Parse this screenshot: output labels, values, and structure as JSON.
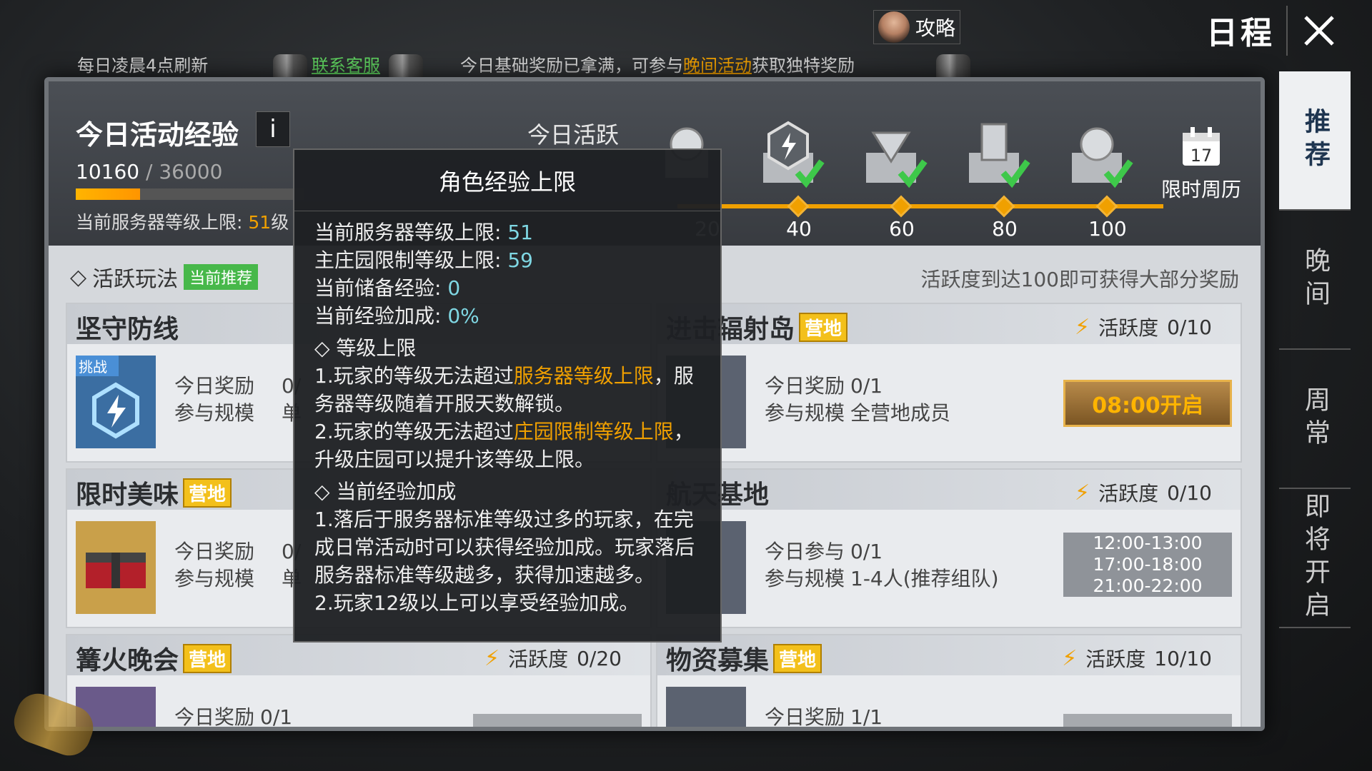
{
  "topbar": {
    "guide_label": "攻略",
    "schedule_title": "日程",
    "refresh_text": "每日凌晨4点刷新",
    "contact_link": "联系客服",
    "notice_pre": "今日基础奖励已拿满，可参与",
    "notice_link": "晚间活动",
    "notice_post": "获取独特奖励"
  },
  "exp": {
    "title": "今日活动经验",
    "info_label": "i",
    "current": "10160",
    "separator": " / ",
    "max": "36000",
    "progress": 0.28,
    "limit_label": "当前服务器等级上限: ",
    "limit_value": "51",
    "limit_unit": "级"
  },
  "activity": {
    "label": "今日活跃",
    "milestones": [
      "20",
      "40",
      "60",
      "80",
      "100"
    ]
  },
  "calendar": {
    "day": "17",
    "label": "限时周历"
  },
  "section": {
    "title": "活跃玩法",
    "tag": "当前推荐",
    "hint": "活跃度到达100即可获得大部分奖励"
  },
  "cards": [
    {
      "name": "坚守防线",
      "tag": "",
      "badge": "挑战",
      "row1_label": "今日奖励",
      "row1_val": "0/",
      "row2_label": "参与规模",
      "row2_val": "单"
    },
    {
      "name": "进击辐射岛",
      "tag": "营地",
      "active_label": "活跃度",
      "active_val": "0/10",
      "row1_label": "今日奖励",
      "row1_val": "0/1",
      "row2_label": "参与规模",
      "row2_val": "全营地成员",
      "button": "08:00开启"
    },
    {
      "name": "限时美味",
      "tag": "营地",
      "row1_label": "今日奖励",
      "row1_val": "0/",
      "row2_label": "参与规模",
      "row2_val": "单"
    },
    {
      "name": "航天基地",
      "tag": "",
      "active_label": "活跃度",
      "active_val": "0/10",
      "row1_label": "今日参与",
      "row1_val": "0/1",
      "row2_label": "参与规模",
      "row2_val": "1-4人(推荐组队)",
      "times": [
        "12:00-13:00",
        "17:00-18:00",
        "21:00-22:00"
      ]
    },
    {
      "name": "篝火晚会",
      "tag": "营地",
      "active_label": "活跃度",
      "active_val": "0/20",
      "row1_label": "今日奖励",
      "row1_val": "0/1"
    },
    {
      "name": "物资募集",
      "tag": "营地",
      "active_label": "活跃度",
      "active_val": "10/10",
      "row1_label": "今日奖励",
      "row1_val": "1/1"
    }
  ],
  "side_tabs": [
    "推荐",
    "晚间",
    "周常",
    "即将开启"
  ],
  "tooltip": {
    "title": "角色经验上限",
    "lines": [
      {
        "label": "当前服务器等级上限: ",
        "value": "51"
      },
      {
        "label": "主庄园限制等级上限: ",
        "value": "59"
      },
      {
        "label": "当前储备经验: ",
        "value": "0"
      },
      {
        "label": "当前经验加成: ",
        "value": "0%"
      }
    ],
    "sec1_title": "◇ 等级上限",
    "sec1_p1_pre": "1.玩家的等级无法超过",
    "sec1_p1_hl": "服务器等级上限",
    "sec1_p1_post": "，服务器等级随着开服天数解锁。",
    "sec1_p2_pre": "2.玩家的等级无法超过",
    "sec1_p2_hl": "庄园限制等级上限",
    "sec1_p2_post": "，升级庄园可以提升该等级上限。",
    "sec2_title": "◇ 当前经验加成",
    "sec2_p1": "1.落后于服务器标准等级过多的玩家，在完成日常活动时可以获得经验加成。玩家落后服务器标准等级越多，获得加速越多。",
    "sec2_p2": "2.玩家12级以上可以享受经验加成。"
  }
}
